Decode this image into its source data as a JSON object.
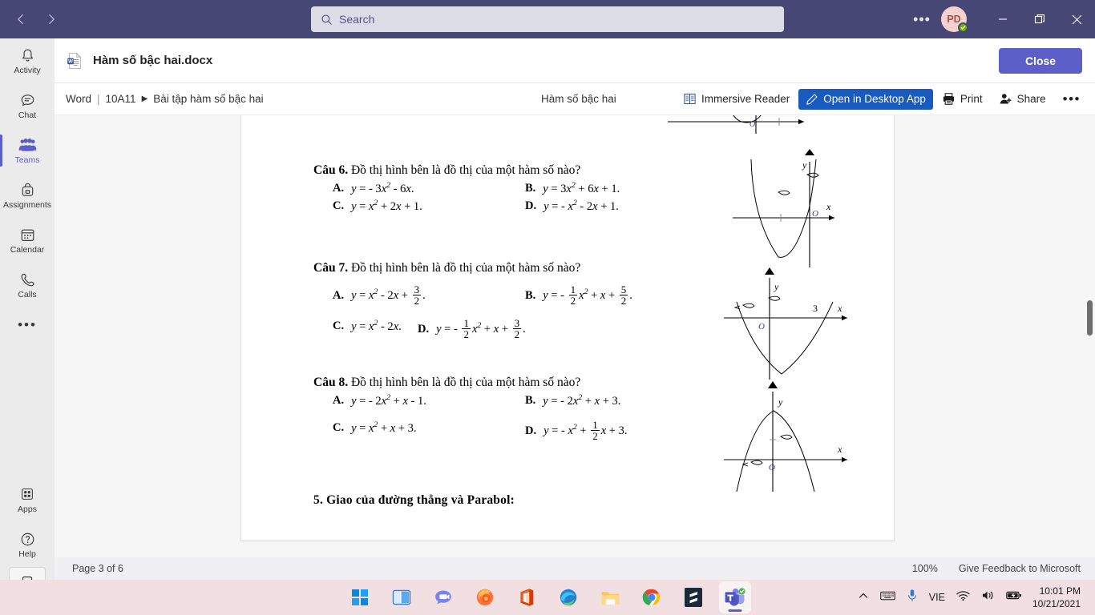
{
  "titlebar": {
    "back_icon": "chevron-left-icon",
    "forward_icon": "chevron-right-icon",
    "search_placeholder": "Search",
    "search_icon": "search-icon",
    "more_label": "•••",
    "avatar_initials": "PD",
    "minimize_label": "—",
    "maximize_label": "▢",
    "close_label": "✕"
  },
  "rail": {
    "items": [
      {
        "label": "Activity",
        "icon": "bell-icon"
      },
      {
        "label": "Chat",
        "icon": "chat-icon"
      },
      {
        "label": "Teams",
        "icon": "teams-people-icon"
      },
      {
        "label": "Assignments",
        "icon": "backpack-icon"
      },
      {
        "label": "Calendar",
        "icon": "calendar-icon"
      },
      {
        "label": "Calls",
        "icon": "phone-icon"
      }
    ],
    "more_label": "•••",
    "apps_label": "Apps",
    "apps_icon": "grid-apps-icon",
    "help_label": "Help",
    "help_icon": "question-circle-icon",
    "download_icon": "download-app-icon"
  },
  "doc_header": {
    "file_icon": "word-doc-icon",
    "file_name": "Hàm số bậc hai.docx",
    "close_label": "Close"
  },
  "toolbar": {
    "app_name": "Word",
    "separator": "|",
    "team_name": "10A11",
    "caret": "▶",
    "channel_name": "Bài tập hàm số bậc hai",
    "doc_subtitle": "Hàm số bậc hai",
    "immersive_reader_label": "Immersive Reader",
    "immersive_reader_icon": "immersive-reader-icon",
    "open_desktop_label": "Open in Desktop App",
    "open_desktop_icon": "pencil-icon",
    "print_label": "Print",
    "print_icon": "printer-icon",
    "share_label": "Share",
    "share_icon": "person-add-icon",
    "more_label": "•••"
  },
  "document": {
    "questions": [
      {
        "label": "Câu 6.",
        "prompt": "Đồ thị hình bên là đồ thị của một hàm số nào?",
        "options": [
          {
            "letter": "A.",
            "text": "y = - 3x² -  6x."
          },
          {
            "letter": "B.",
            "text": "y = 3x² + 6x + 1."
          },
          {
            "letter": "C.",
            "text": "y = x² + 2x + 1."
          },
          {
            "letter": "D.",
            "text": "y = - x² - 2x + 1."
          }
        ]
      },
      {
        "label": "Câu 7.",
        "prompt": "Đồ thị hình bên là đồ thị của một hàm số nào?",
        "options": [
          {
            "letter": "A.",
            "text": "y = x² - 2x + 3/2."
          },
          {
            "letter": "B.",
            "text": "y = - 1/2 x² + x + 5/2."
          },
          {
            "letter": "C.",
            "text": "y = x² - 2x."
          },
          {
            "letter": "D.",
            "text": "y = - 1/2 x² + x + 3/2."
          }
        ]
      },
      {
        "label": "Câu 8.",
        "prompt": "Đồ thị hình bên là đồ thị của một hàm số nào?",
        "options": [
          {
            "letter": "A.",
            "text": "y = - 2x² + x - 1."
          },
          {
            "letter": "B.",
            "text": "y = - 2x² + x + 3."
          },
          {
            "letter": "C.",
            "text": "y = x² + x + 3."
          },
          {
            "letter": "D.",
            "text": "y = - x² + 1/2 x + 3."
          }
        ]
      }
    ],
    "section_heading": "5. Giao của đường thẳng và Parabol:",
    "graph_labels": {
      "x": "x",
      "y": "y",
      "origin": "O",
      "tick_3": "3"
    }
  },
  "status": {
    "page_info": "Page 3 of 6",
    "zoom": "100%",
    "feedback": "Give Feedback to Microsoft"
  },
  "taskbar": {
    "apps": [
      {
        "name": "start-windows-icon"
      },
      {
        "name": "task-view-icon"
      },
      {
        "name": "teams-chat-icon"
      },
      {
        "name": "firefox-icon"
      },
      {
        "name": "office-icon"
      },
      {
        "name": "edge-icon"
      },
      {
        "name": "file-explorer-icon"
      },
      {
        "name": "chrome-icon"
      },
      {
        "name": "sublime-text-icon"
      },
      {
        "name": "microsoft-teams-icon"
      }
    ],
    "tray": {
      "chevron_up_icon": "chevron-up-icon",
      "keyboard_icon": "keyboard-icon",
      "mic_icon": "microphone-icon",
      "language": "VIE",
      "wifi_icon": "wifi-icon",
      "volume_icon": "speaker-icon",
      "battery_icon": "battery-charging-icon",
      "time": "10:01 PM",
      "date": "10/21/2021"
    }
  },
  "colors": {
    "teams_purple": "#464775",
    "accent": "#5b5fc7",
    "word_blue": "#185abd",
    "taskbar": "#f1dfe1"
  }
}
